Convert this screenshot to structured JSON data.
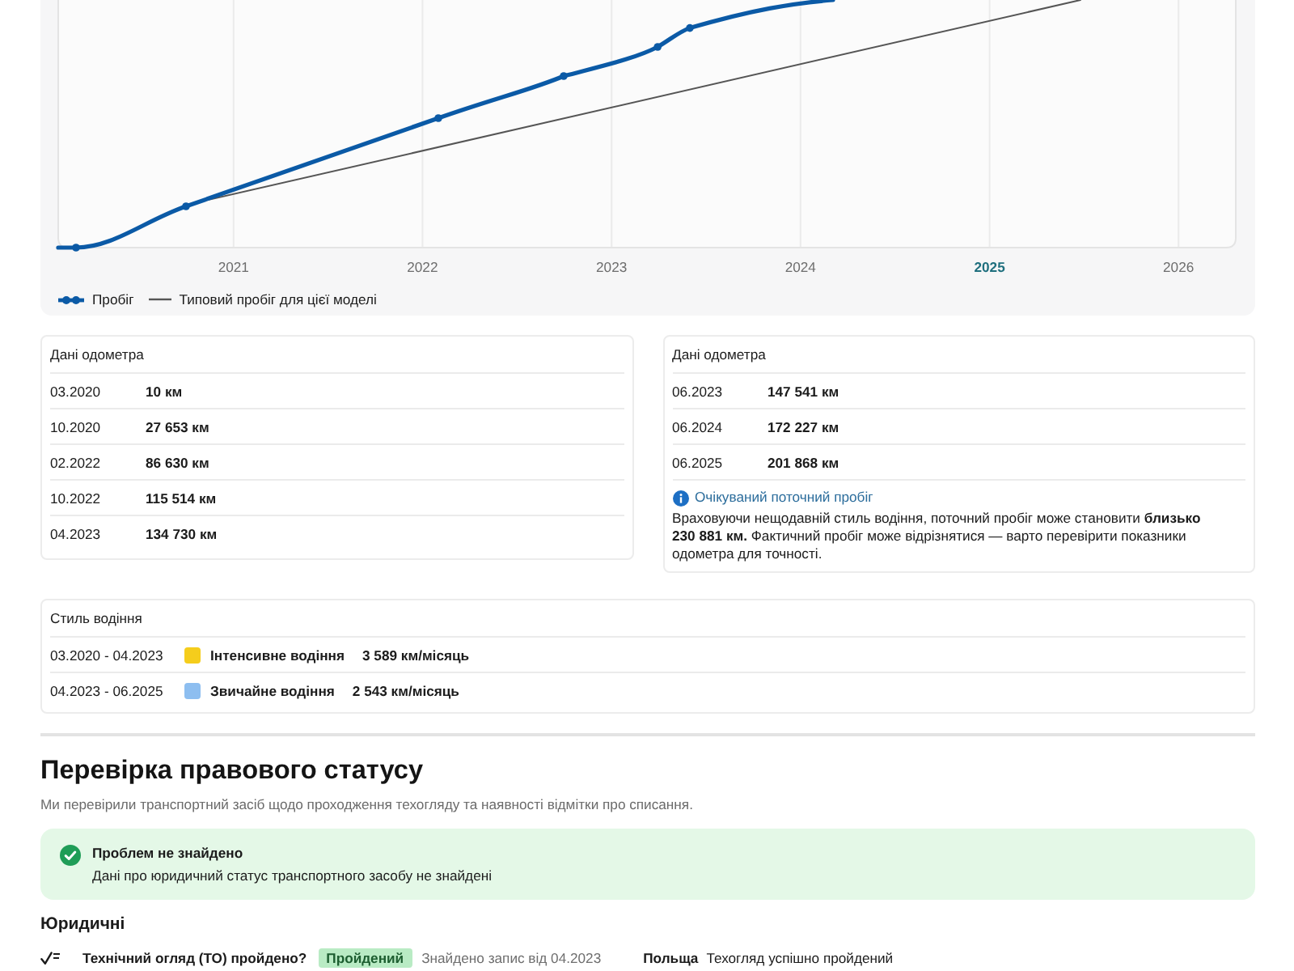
{
  "chart": {
    "x_labels": [
      {
        "label": "2021",
        "highlighted": false
      },
      {
        "label": "2022",
        "highlighted": false
      },
      {
        "label": "2023",
        "highlighted": false
      },
      {
        "label": "2024",
        "highlighted": false
      },
      {
        "label": "2025",
        "highlighted": true
      },
      {
        "label": "2026",
        "highlighted": false
      }
    ],
    "legend": [
      {
        "label": "Пробіг",
        "kind": "marker-line",
        "color": "#0b5aa6"
      },
      {
        "label": "Типовий пробіг для цієї моделі",
        "kind": "line",
        "color": "#555555"
      }
    ]
  },
  "odometer_cards": [
    {
      "title": "Дані одометра",
      "rows": [
        {
          "date": "03.2020",
          "mileage": "10 км"
        },
        {
          "date": "10.2020",
          "mileage": "27 653 км"
        },
        {
          "date": "02.2022",
          "mileage": "86 630 км"
        },
        {
          "date": "10.2022",
          "mileage": "115 514 км"
        },
        {
          "date": "04.2023",
          "mileage": "134 730 км"
        }
      ]
    },
    {
      "title": "Дані одометра",
      "rows": [
        {
          "date": "06.2023",
          "mileage": "147 541 км"
        },
        {
          "date": "06.2024",
          "mileage": "172 227 км"
        },
        {
          "date": "06.2025",
          "mileage": "201 868 км"
        }
      ],
      "note": {
        "title": "Очікуваний поточний пробіг",
        "text": "Враховуючи нещодавній стиль водіння, поточний пробіг може становити **близько 230 881 км.** Фактичний пробіг може відрізнятися — варто перевірити показники одометра для точності."
      }
    }
  ],
  "driving_style": {
    "title": "Стиль водіння",
    "rows": [
      {
        "period": "03.2020 - 04.2023",
        "color": "#f5cd1c",
        "label": "Інтенсивне водіння",
        "rate": "3 589 км/місяць"
      },
      {
        "period": "04.2023 - 06.2025",
        "color": "#8dbef0",
        "label": "Звичайне водіння",
        "rate": "2 543 км/місяць"
      }
    ]
  },
  "legal_status": {
    "title": "Перевірка правового статусу",
    "description": "Ми перевірили транспортний засіб щодо проходження техогляду та наявності відмітки про списання.",
    "alert": {
      "kind": "success",
      "title": "Проблем не знайдено",
      "text": "Дані про юридичний статус транспортного засобу не знайдені"
    },
    "group_title": "Юридичні",
    "checks": [
      {
        "question": "Технічний огляд (ТО) пройдено?",
        "passed": true,
        "badge": "Пройдений",
        "record": "Знайдено запис від 04.2023",
        "country": "Польща",
        "result": "Техогляд успішно пройдений"
      }
    ]
  }
}
